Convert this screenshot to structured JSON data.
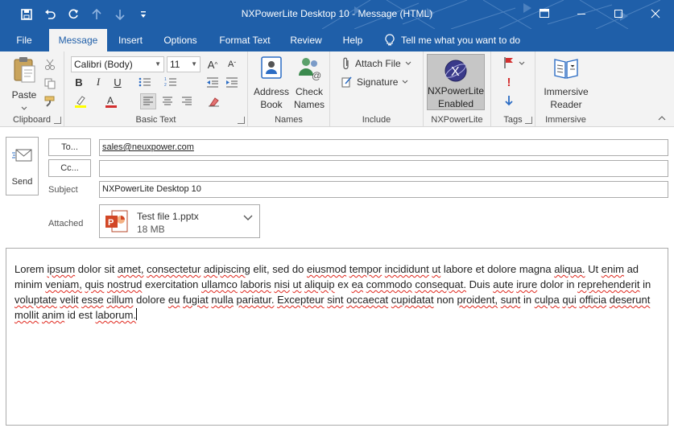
{
  "window": {
    "title": "NXPowerLite Desktop 10  -  Message (HTML)"
  },
  "tabs": [
    {
      "label": "File"
    },
    {
      "label": "Message"
    },
    {
      "label": "Insert"
    },
    {
      "label": "Options"
    },
    {
      "label": "Format Text"
    },
    {
      "label": "Review"
    },
    {
      "label": "Help"
    }
  ],
  "tellme": "Tell me what you want to do",
  "ribbon": {
    "clipboard": {
      "label": "Clipboard",
      "paste": "Paste"
    },
    "basic_text": {
      "label": "Basic Text",
      "font": "Calibri (Body)",
      "size": "11"
    },
    "names": {
      "label": "Names",
      "address_book": [
        "Address",
        "Book"
      ],
      "check_names": [
        "Check",
        "Names"
      ]
    },
    "include": {
      "label": "Include",
      "attach_file": "Attach File",
      "signature": "Signature"
    },
    "nxpowerlite": {
      "label": "NXPowerLite",
      "button": [
        "NXPowerLite",
        "Enabled"
      ]
    },
    "tags": {
      "label": "Tags"
    },
    "immersive": {
      "label": "Immersive",
      "button": [
        "Immersive",
        "Reader"
      ]
    }
  },
  "compose": {
    "send": "Send",
    "to_button": "To...",
    "cc_button": "Cc...",
    "to_value": "sales@neuxpower.com",
    "cc_value": "",
    "subject_label": "Subject",
    "subject_value": "NXPowerLite Desktop 10",
    "attached_label": "Attached",
    "attachment": {
      "name": "Test file 1.pptx",
      "size": "18 MB"
    }
  },
  "body_text": "Lorem ipsum dolor sit amet, consectetur adipiscing elit, sed do eiusmod tempor incididunt ut labore et dolore magna aliqua. Ut enim ad minim veniam, quis nostrud exercitation ullamco laboris nisi ut aliquip ex ea commodo consequat. Duis aute irure dolor in reprehenderit in voluptate velit esse cillum dolore eu fugiat nulla pariatur. Excepteur sint occaecat cupidatat non proident, sunt in culpa qui officia deserunt mollit anim id est laborum.",
  "colors": {
    "titlebar": "#1f5fa9",
    "ribbon": "#f3f3f3",
    "spellcheck": "#e0261c",
    "powerpoint": "#d24726"
  }
}
